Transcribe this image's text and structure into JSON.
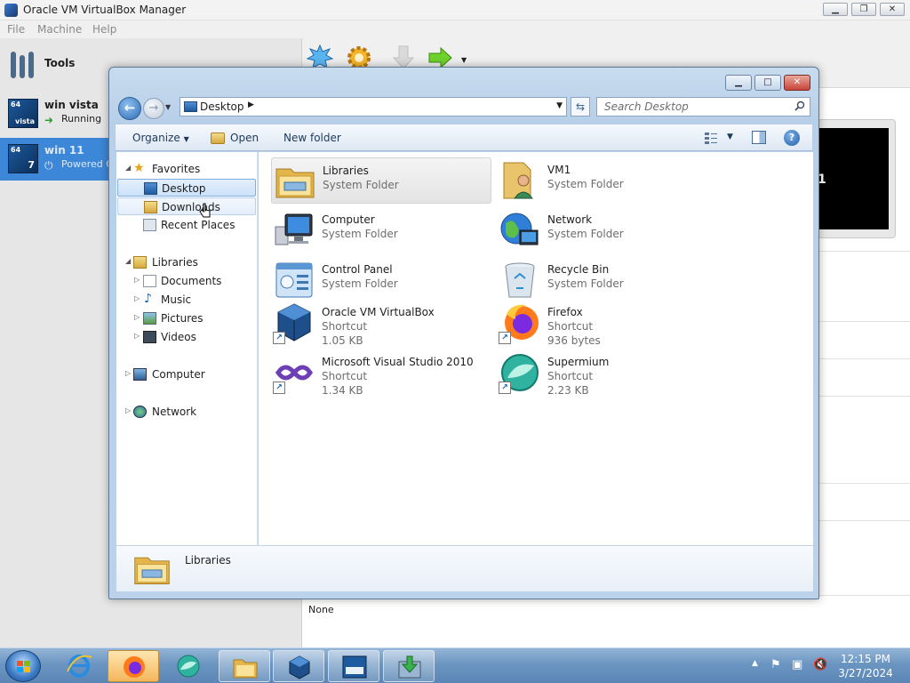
{
  "vbox": {
    "window_title": "Oracle VM VirtualBox Manager",
    "menu": [
      "File",
      "Machine",
      "Help"
    ],
    "tools_label": "Tools",
    "vms": [
      {
        "name": "win vista",
        "state": "Running",
        "bits": "64",
        "os_badge": "vista"
      },
      {
        "name": "win 11",
        "state": "Powered Off",
        "bits": "64",
        "os_badge": "7"
      }
    ],
    "preview_text": "1",
    "details_none": "None",
    "colors": {
      "selection": "#3d87d8"
    }
  },
  "explorer": {
    "address": "Desktop",
    "search_placeholder": "Search Desktop",
    "commands": {
      "organize": "Organize",
      "open": "Open",
      "new_folder": "New folder"
    },
    "nav": {
      "favorites": "Favorites",
      "favorites_items": [
        "Desktop",
        "Downloads",
        "Recent Places"
      ],
      "libraries": "Libraries",
      "libraries_items": [
        "Documents",
        "Music",
        "Pictures",
        "Videos"
      ],
      "computer": "Computer",
      "network": "Network"
    },
    "items": [
      {
        "name": "Libraries",
        "type": "System Folder",
        "icon": "libraries-icon"
      },
      {
        "name": "VM1",
        "type": "System Folder",
        "icon": "user-folder-icon"
      },
      {
        "name": "Computer",
        "type": "System Folder",
        "icon": "computer-icon"
      },
      {
        "name": "Network",
        "type": "System Folder",
        "icon": "network-icon"
      },
      {
        "name": "Control Panel",
        "type": "System Folder",
        "icon": "control-panel-icon"
      },
      {
        "name": "Recycle Bin",
        "type": "System Folder",
        "icon": "recycle-bin-icon"
      },
      {
        "name": "Oracle VM VirtualBox",
        "type": "Shortcut",
        "size": "1.05 KB",
        "icon": "virtualbox-icon"
      },
      {
        "name": "Firefox",
        "type": "Shortcut",
        "size": "936 bytes",
        "icon": "firefox-icon"
      },
      {
        "name": "Microsoft Visual Studio 2010",
        "type": "Shortcut",
        "size": "1.34 KB",
        "icon": "visual-studio-icon"
      },
      {
        "name": "Supermium",
        "type": "Shortcut",
        "size": "2.23 KB",
        "icon": "supermium-icon"
      }
    ],
    "details": {
      "name": "Libraries"
    }
  },
  "taskbar": {
    "clock_time": "12:15 PM",
    "clock_date": "3/27/2024",
    "pinned": [
      "internet-explorer-icon",
      "firefox-icon",
      "supermium-icon",
      "explorer-icon",
      "virtualbox-icon",
      "win-vista-vm-icon",
      "download-icon"
    ]
  }
}
